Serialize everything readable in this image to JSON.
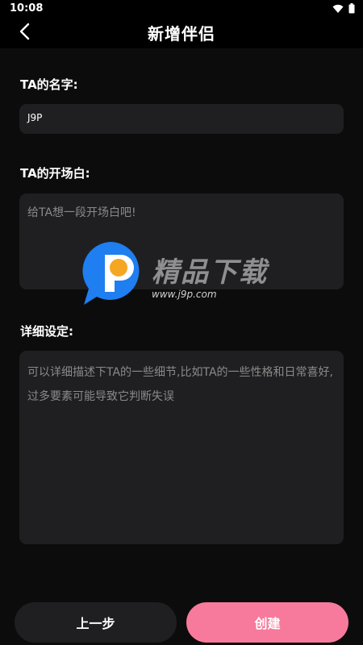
{
  "status_bar": {
    "time": "10:08"
  },
  "header": {
    "title": "新增伴侣"
  },
  "form": {
    "name_label": "TA的名字:",
    "name_value": "J9P",
    "opening_label": "TA的开场白:",
    "opening_placeholder": "给TA想一段开场白吧!",
    "detail_label": "详细设定:",
    "detail_placeholder": "可以详细描述下TA的一些细节,比如TA的一些性格和日常喜好,过多要素可能导致它判断失误"
  },
  "watermark": {
    "text": "精品下载",
    "url": "www.j9p.com"
  },
  "buttons": {
    "prev_label": "上一步",
    "create_label": "创建"
  },
  "colors": {
    "background": "#0c0c0c",
    "input_bg": "#1f1f21",
    "accent": "#f77a9c"
  }
}
